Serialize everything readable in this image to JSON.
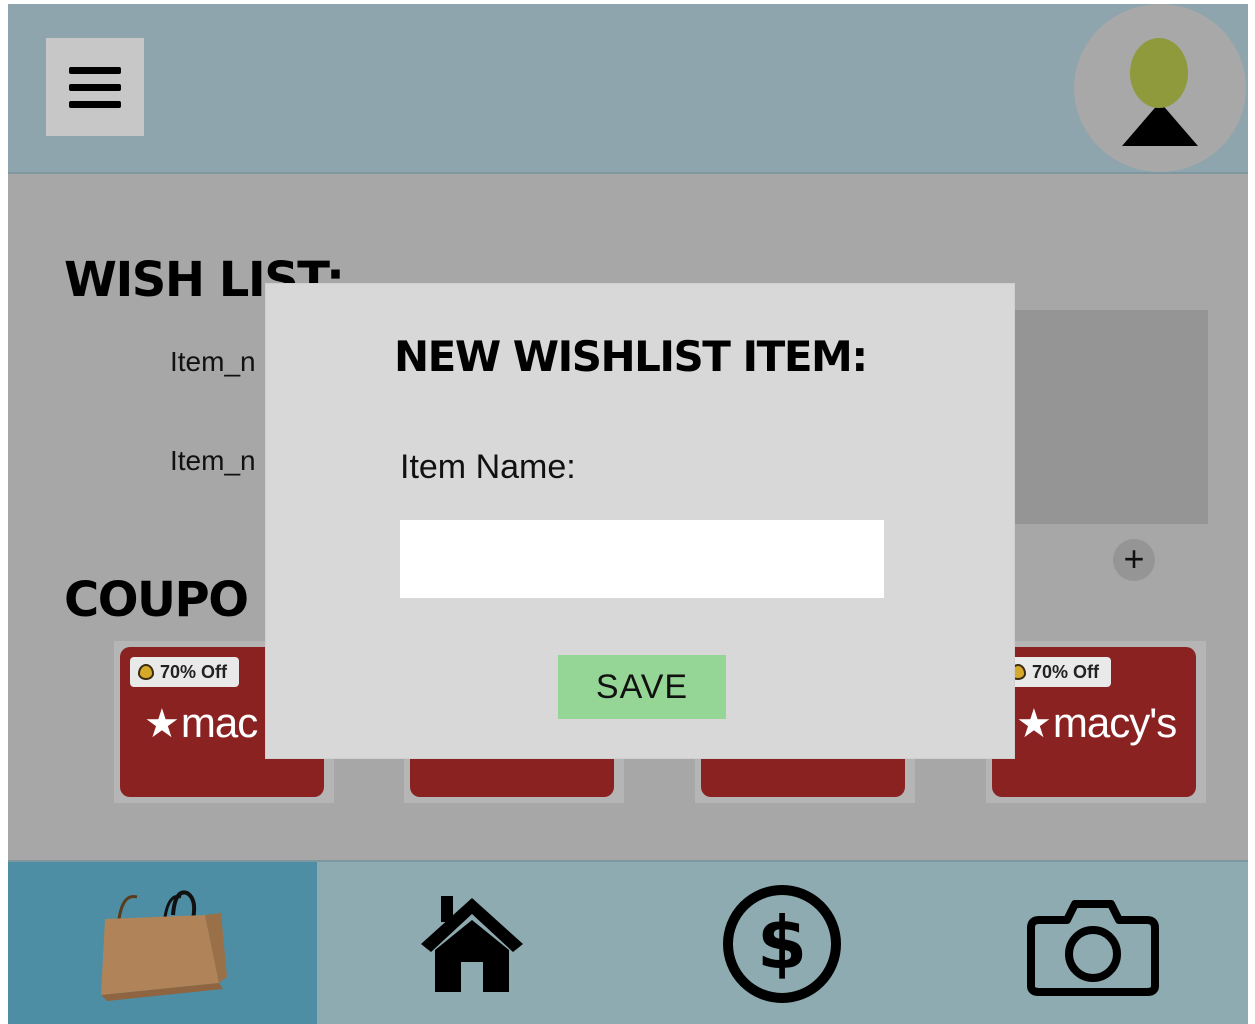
{
  "header": {
    "menu_icon": "hamburger-menu-icon",
    "avatar_icon": "user-avatar-icon"
  },
  "wishlist": {
    "title": "WISH LIST:",
    "items": [
      "Item_n",
      "Item_n"
    ],
    "add_icon": "plus-icon"
  },
  "coupons": {
    "title": "COUPO",
    "cards": [
      {
        "badge": "70% Off",
        "brand": "mac",
        "star": "★"
      },
      {
        "badge": "",
        "brand": "",
        "star": ""
      },
      {
        "badge": "",
        "brand": "",
        "star": ""
      },
      {
        "badge": "70% Off",
        "brand": "macy's",
        "star": "★"
      }
    ]
  },
  "modal": {
    "title": "NEW WISHLIST ITEM:",
    "field_label": "Item Name:",
    "input_value": "",
    "input_placeholder": "",
    "save_label": "SAVE"
  },
  "nav": {
    "items": [
      {
        "icon": "shopping-bag-icon",
        "active": true
      },
      {
        "icon": "home-icon",
        "active": false
      },
      {
        "icon": "dollar-icon",
        "active": false
      },
      {
        "icon": "camera-icon",
        "active": false
      }
    ]
  },
  "colors": {
    "header_bg": "#8ea5ad",
    "content_bg": "#a7a7a7",
    "nav_active": "#4d8ea5",
    "coupon_red": "#8b2222",
    "save_green": "#95d696",
    "modal_bg": "#d8d8d8"
  }
}
